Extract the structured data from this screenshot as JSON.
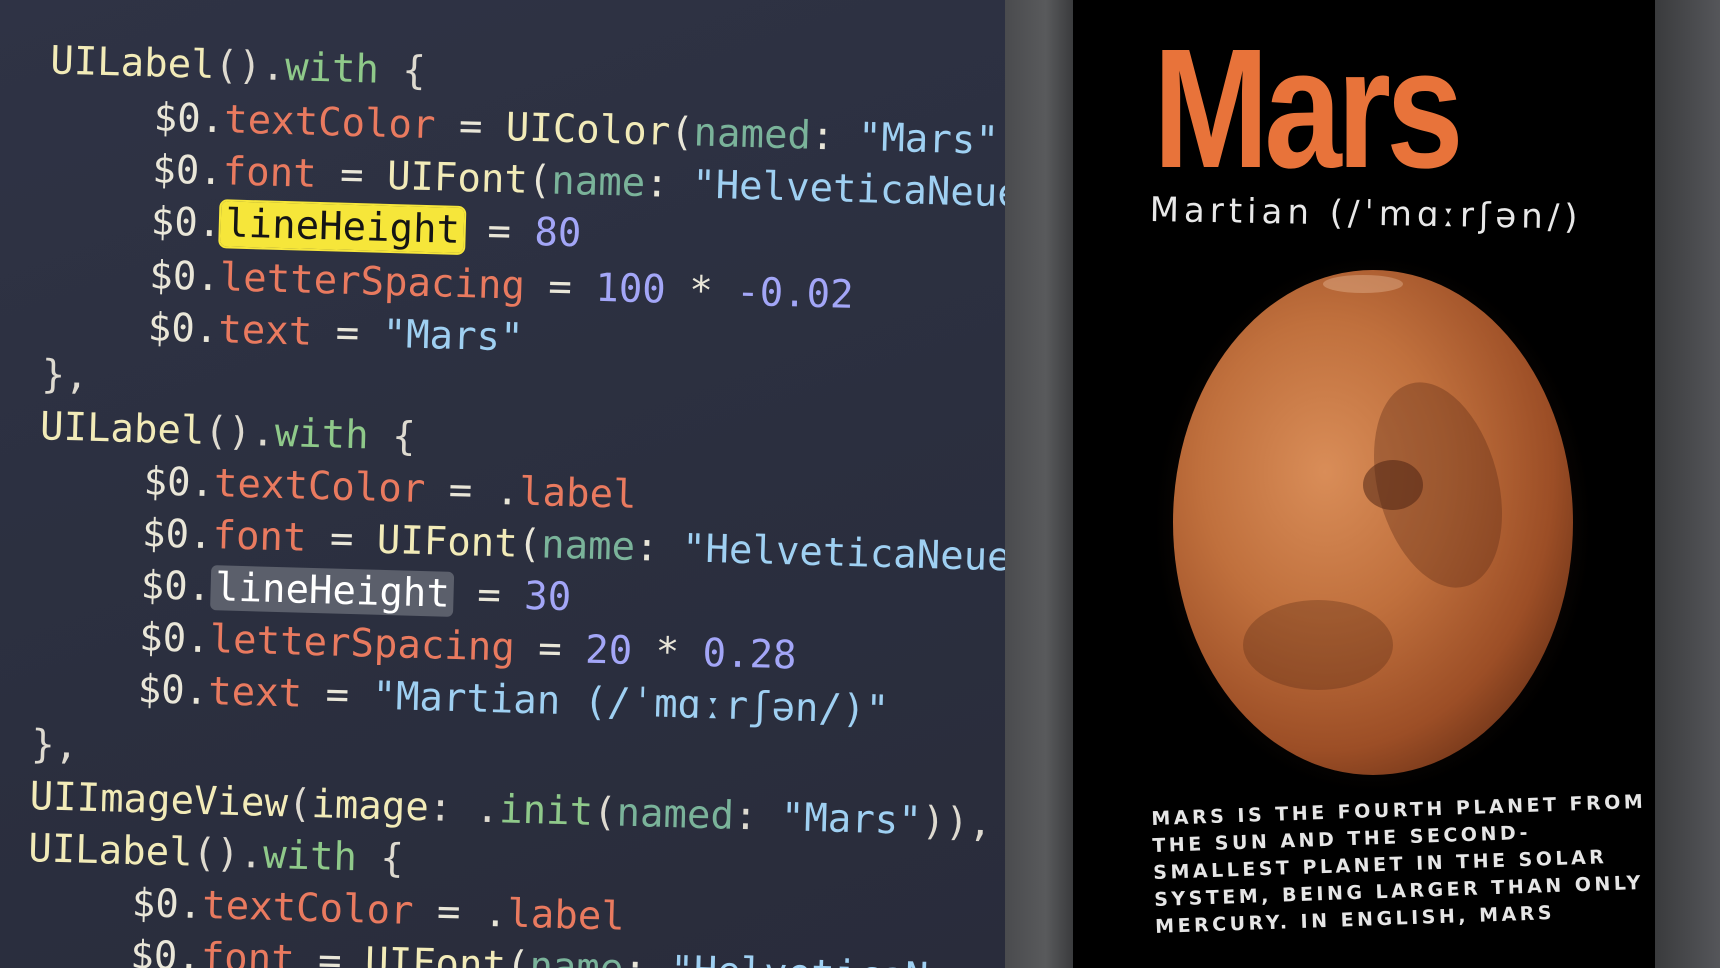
{
  "code": {
    "kw_uilabel": "UILabel",
    "kw_uiimageview": "UIImageView",
    "kw_with": "with",
    "kw_init": "init",
    "kw_uicolor": "UIColor",
    "kw_uifont": "UIFont",
    "dollar0": "$0",
    "prop_textColor": "textColor",
    "prop_font": "font",
    "prop_lineHeight": "lineHeight",
    "prop_letterSpacing": "letterSpacing",
    "prop_text": "text",
    "arg_named": "named",
    "arg_name": "name",
    "arg_image": "image",
    "val_label": "label",
    "str_mars_color": "\"Mars\"",
    "str_helvetica_trunc": "\"HelveticaNeue-",
    "str_helvetica": "\"HelveticaNeue\"",
    "str_mars": "\"Mars\"",
    "str_martian": "\"Martian (/ˈmɑːrʃən/)\"",
    "str_mars_image": "\"Mars\"",
    "str_helvetica_trunc2": "\"HelveticaNeue-",
    "num_80": "80",
    "num_100": "100",
    "num_neg002": "-0.02",
    "num_30": "30",
    "num_20": "20",
    "num_028": "0.28"
  },
  "device": {
    "title": "Mars",
    "subtitle": "Martian (/ˈmɑːrʃən/)",
    "body_lines": [
      "Mars is the fourth planet from",
      "the Sun and the second-",
      "smallest planet in the Solar",
      "System, being larger than only",
      "Mercury. In English, Mars"
    ]
  },
  "colors": {
    "mars_accent": "#e8733a",
    "highlight_yellow": "#f6e63a",
    "editor_bg": "#2d3142"
  }
}
